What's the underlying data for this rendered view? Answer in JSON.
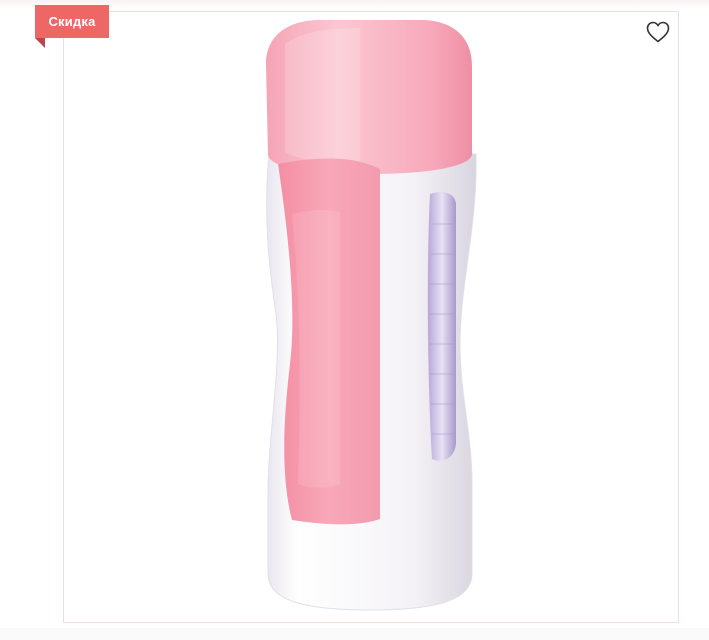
{
  "badge": {
    "label": "Скидка",
    "color": "#ee6767"
  },
  "favorite": {
    "icon": "heart-outline-icon"
  },
  "product_image": {
    "description_icon": "wax-heater-cartridge-image"
  }
}
